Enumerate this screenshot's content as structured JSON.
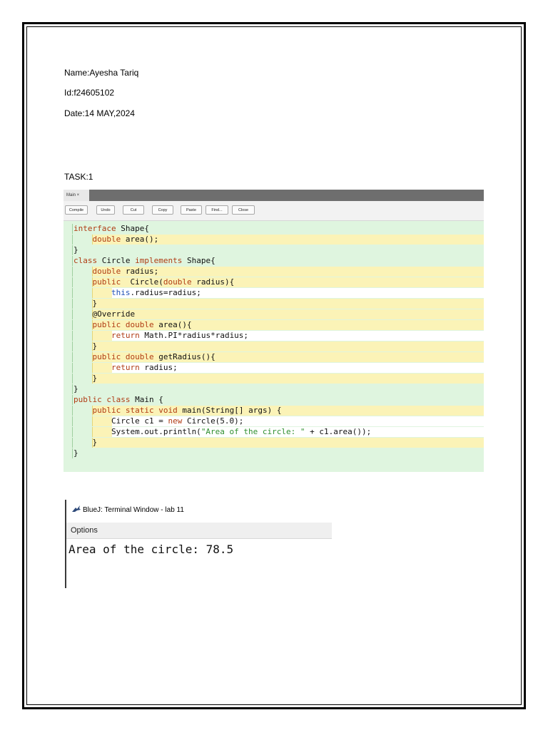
{
  "document": {
    "name_line": "Name:Ayesha Tariq",
    "id_line": "Id:f24605102",
    "date_line": "Date:14 MAY,2024",
    "task_line": "TASK:1"
  },
  "editor": {
    "tab_label": "Main ×",
    "toolbar": [
      "Compile",
      "Undo",
      "Cut",
      "Copy",
      "Paste",
      "Find...",
      "Close"
    ],
    "code_lines": [
      {
        "text": "interface Shape{"
      },
      {
        "text": "    double area();"
      },
      {
        "text": "}"
      },
      {
        "text": "class Circle implements Shape{"
      },
      {
        "text": "    double radius;"
      },
      {
        "text": "    public  Circle(double radius){"
      },
      {
        "text": "        this.radius=radius;"
      },
      {
        "text": "    }"
      },
      {
        "text": "    @Override"
      },
      {
        "text": "    public double area(){"
      },
      {
        "text": "        return Math.PI*radius*radius;"
      },
      {
        "text": "    }"
      },
      {
        "text": "    public double getRadius(){"
      },
      {
        "text": "        return radius;"
      },
      {
        "text": "    }"
      },
      {
        "text": "}"
      },
      {
        "text": "public class Main {"
      },
      {
        "text": "    public static void main(String[] args) {"
      },
      {
        "text": "        Circle c1 = new Circle(5.0);"
      },
      {
        "text": "        System.out.println(\"Area of the circle: \" + c1.area());"
      },
      {
        "text": "    }"
      },
      {
        "text": "}"
      }
    ]
  },
  "terminal": {
    "title": "BlueJ: Terminal Window - lab 11",
    "menu": "Options",
    "output": "Area of the circle: 78.5"
  },
  "colors": {
    "keyword": "#b03c14",
    "class_block_bg": "#dff5df",
    "method_block_bg": "#fbf3b7",
    "inner_block_bg": "#ffffff",
    "toolbar_bg": "#f2f2f2",
    "tabbar_bg": "#6e6e6e"
  },
  "icons": {
    "terminal": "bluej-bird-icon"
  }
}
